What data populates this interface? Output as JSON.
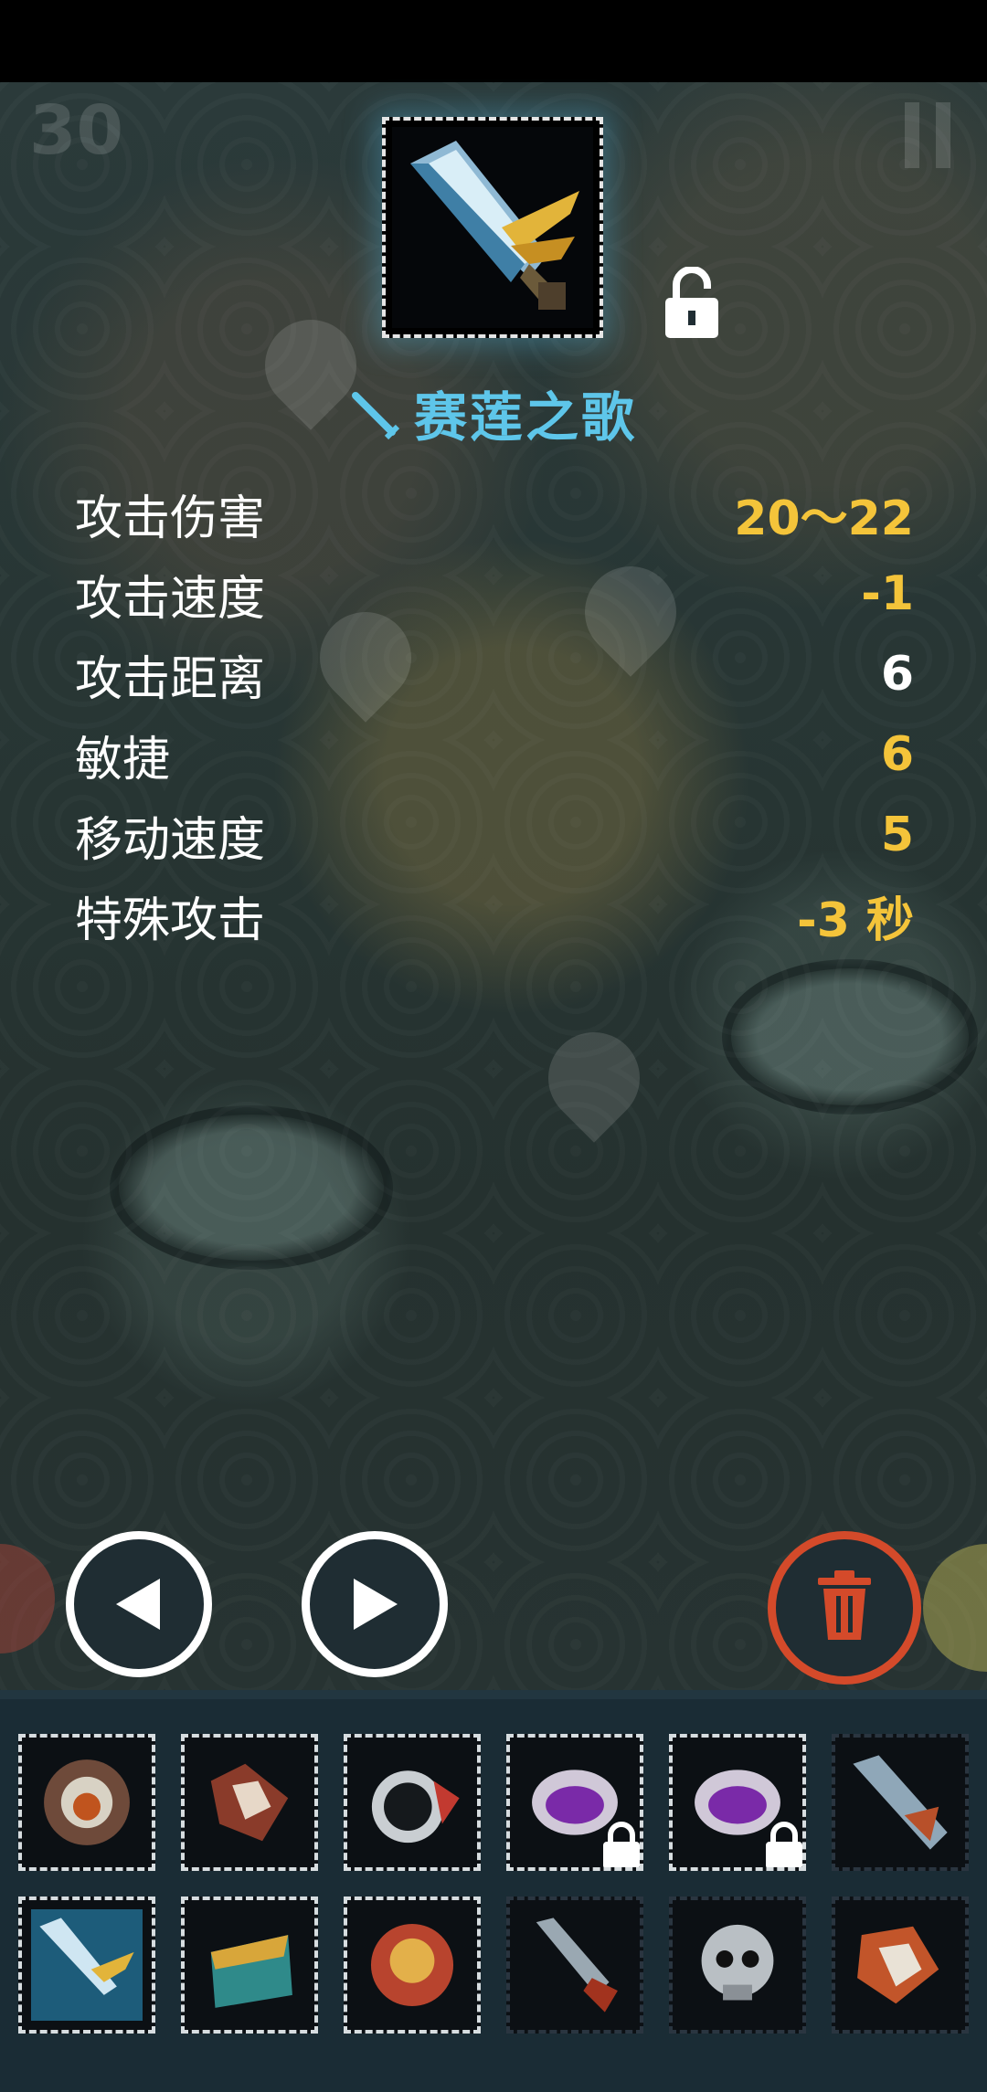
{
  "hud": {
    "counter": "30"
  },
  "item": {
    "name": "赛莲之歌",
    "icon": "sword-item-icon",
    "lock_icon": "unlock-icon"
  },
  "stats": [
    {
      "label": "攻击伤害",
      "value": "20～22",
      "color": "#f4c43a"
    },
    {
      "label": "攻击速度",
      "value": "-1",
      "color": "#f4c43a"
    },
    {
      "label": "攻击距离",
      "value": "6",
      "color": "#ffffff"
    },
    {
      "label": "敏捷",
      "value": "6",
      "color": "#f4c43a"
    },
    {
      "label": "移动速度",
      "value": "5",
      "color": "#f4c43a"
    },
    {
      "label": "特殊攻击",
      "value": "-3 秒",
      "color": "#f4c43a"
    }
  ],
  "controls": {
    "prev": "previous-arrow-icon",
    "next": "next-arrow-icon",
    "delete": "trash-icon"
  },
  "inventory": [
    {
      "name": "armor-item-icon",
      "locked": false
    },
    {
      "name": "claw-item-icon",
      "locked": false
    },
    {
      "name": "helmet-item-icon",
      "locked": false
    },
    {
      "name": "ring-item-icon",
      "locked": true
    },
    {
      "name": "ring-item-icon",
      "locked": true
    },
    {
      "name": "blade-item-icon",
      "locked": false
    },
    {
      "name": "sword-item-icon",
      "locked": false
    },
    {
      "name": "chest-item-icon",
      "locked": false
    },
    {
      "name": "crest-item-icon",
      "locked": false
    },
    {
      "name": "dagger-item-icon",
      "locked": false
    },
    {
      "name": "skull-item-icon",
      "locked": false
    },
    {
      "name": "axe-item-icon",
      "locked": false
    }
  ],
  "colors": {
    "accent": "#5ec6ea",
    "highlight": "#f4c43a",
    "danger": "#d44a2a"
  }
}
